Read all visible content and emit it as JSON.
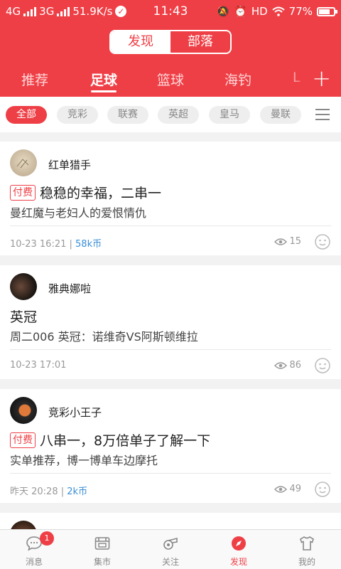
{
  "status_bar": {
    "network_left": "4G",
    "network_right": "3G",
    "speed": "51.9K/s",
    "time": "11:43",
    "hd": "HD",
    "battery": "77%"
  },
  "segment": {
    "left": "发现",
    "right": "部落",
    "active": "left"
  },
  "tabs": [
    "推荐",
    "足球",
    "篮球",
    "海钓",
    "L"
  ],
  "active_tab": 1,
  "filters": [
    "全部",
    "竞彩",
    "联赛",
    "英超",
    "皇马",
    "曼联"
  ],
  "active_filter": 0,
  "posts": [
    {
      "author": "红单猎手",
      "paid_label": "付费",
      "title": "稳稳的幸福，二串一",
      "subtitle": "曼红魔与老妇人的爱恨情仇",
      "time": "10-23 16:21",
      "separator": " | ",
      "price": "58k币",
      "views": "15"
    },
    {
      "author": "雅典娜啦",
      "paid_label": "",
      "title": "英冠",
      "subtitle": "周二006 英冠：诺维奇VS阿斯顿维拉",
      "time": "10-23 17:01",
      "separator": "",
      "price": "",
      "views": "86"
    },
    {
      "author": "竞彩小王子",
      "paid_label": "付费",
      "title": "八串一，8万倍单子了解一下",
      "subtitle": "实单推荐，博一博单车边摩托",
      "time": "昨天 20:28",
      "separator": " | ",
      "price": "2k币",
      "views": "49"
    }
  ],
  "bottom_nav": [
    {
      "label": "消息",
      "icon": "message-icon",
      "badge": "1"
    },
    {
      "label": "集市",
      "icon": "market-icon",
      "badge": ""
    },
    {
      "label": "关注",
      "icon": "whistle-icon",
      "badge": ""
    },
    {
      "label": "发现",
      "icon": "compass-icon",
      "badge": ""
    },
    {
      "label": "我的",
      "icon": "jersey-icon",
      "badge": ""
    }
  ],
  "active_nav": 3,
  "colors": {
    "brand_red": "#ef3f46",
    "coin_blue": "#3a8fd8"
  }
}
